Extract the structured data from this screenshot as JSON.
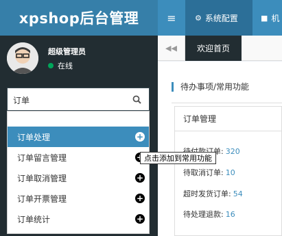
{
  "header": {
    "brand": "xpshop后台管理",
    "toggle_icon": "menu-icon",
    "nav": [
      {
        "label": "系统配置",
        "icon": "gears-icon"
      },
      {
        "label": "机",
        "icon": "truck-icon"
      }
    ]
  },
  "user": {
    "name": "超级管理员",
    "status": "在线"
  },
  "search": {
    "value": "订单",
    "icon": "search-icon"
  },
  "suggestions": [
    {
      "label": "订单处理"
    },
    {
      "label": "订单留言管理"
    },
    {
      "label": "订单取消管理"
    },
    {
      "label": "订单开票管理"
    },
    {
      "label": "订单统计"
    }
  ],
  "tooltip": "点击添加到常用功能",
  "tabs": {
    "home": "欢迎首页"
  },
  "content": {
    "section_title": "待办事项/常用功能",
    "box_title": "订单管理",
    "rows": [
      {
        "label": "待付款订单:",
        "value": "320"
      },
      {
        "label": "待取消订单:",
        "value": "10"
      },
      {
        "label": "超时发货订单:",
        "value": "54"
      },
      {
        "label": "待处理退款:",
        "value": "16"
      }
    ]
  },
  "colors": {
    "header": "#3c8dbc",
    "brand_bg": "#367fa9",
    "sidebar": "#222d32",
    "highlight": "#3c8dbc"
  }
}
